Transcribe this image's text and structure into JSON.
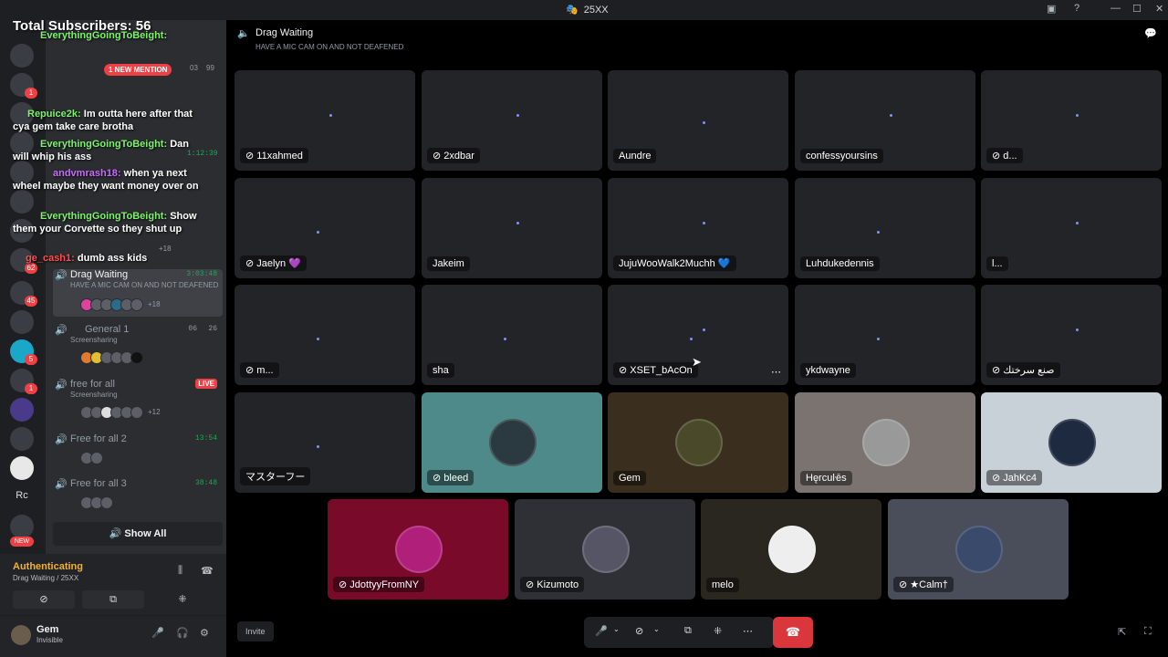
{
  "window": {
    "title": "25XX",
    "controls": [
      "inbox-icon",
      "help-icon",
      "minimize",
      "maximize",
      "close"
    ]
  },
  "overlay": {
    "total_subscribers": "Total Subscribers: 56",
    "mention_pill": "1 NEW MENTION",
    "messages": [
      {
        "user": "EverythingGoingToBeight:",
        "text": ""
      },
      {
        "user": "Repuice2k:",
        "text": "Im outta here after that cya gem take care brotha"
      },
      {
        "user": "EverythingGoingToBeight:",
        "text": "Dan will whip his ass"
      },
      {
        "user": "andvmrash18:",
        "text": "when ya next wheel maybe they want money over on"
      },
      {
        "user": "EverythingGoingToBeight:",
        "text": "Show them your Corvette so they shut up"
      },
      {
        "user": "ge_cash1:",
        "text": "dumb ass kids"
      }
    ]
  },
  "servers": {
    "badges": [
      "1",
      "62",
      "45",
      "5",
      "1"
    ],
    "rc_label": "Rc",
    "new_label": "NEW"
  },
  "channels": {
    "top_counts": {
      "left": "03",
      "right": "99"
    },
    "time_top": "1:12:39",
    "plus_top": "+18",
    "list": [
      {
        "name": "Drag Waiting",
        "sub": "HAVE A MIC CAM ON AND NOT DEAFENED",
        "time": "3:03:48",
        "more": "+18"
      },
      {
        "name": "General 1",
        "sub": "Screensharing",
        "cams": "06",
        "users": "26"
      },
      {
        "name": "free for all",
        "sub": "Screensharing",
        "live": "LIVE",
        "more": "+12"
      },
      {
        "name": "Free for all 2",
        "time": "13:54"
      },
      {
        "name": "Free for all 3",
        "time": "38:48"
      }
    ],
    "show_all": "Show All"
  },
  "voice_panel": {
    "status": "Authenticating",
    "location": "Drag Waiting / 25XX"
  },
  "user_panel": {
    "name": "Gem",
    "status": "Invisible"
  },
  "header": {
    "channel": "Drag Waiting",
    "subtitle": "HAVE A MIC CAM ON AND NOT DEAFENED"
  },
  "tiles": [
    {
      "label": "11xahmed",
      "muted": true
    },
    {
      "label": "2xdbar",
      "muted": true
    },
    {
      "label": "Aundre",
      "muted": false
    },
    {
      "label": "confessyoursins",
      "muted": false
    },
    {
      "label": "d...",
      "muted": true
    },
    {
      "label": "Jaelyn 💜",
      "muted": true
    },
    {
      "label": "Jakeim",
      "muted": false
    },
    {
      "label": "JujuWooWalk2Muchh 💙",
      "muted": false
    },
    {
      "label": "Luhdukedennis",
      "muted": false
    },
    {
      "label": "l...",
      "muted": false
    },
    {
      "label": "m...",
      "muted": true
    },
    {
      "label": "sha",
      "muted": false
    },
    {
      "label": "XSET_bAcOn",
      "muted": true
    },
    {
      "label": "ykdwayne",
      "muted": false
    },
    {
      "label": "صنع سرختك",
      "muted": true
    },
    {
      "label": "マスターフー",
      "muted": false
    },
    {
      "label": "bleed",
      "muted": true
    },
    {
      "label": "Gem",
      "muted": false
    },
    {
      "label": "Hęrcuŀēs",
      "muted": false
    },
    {
      "label": "JahKc4",
      "muted": true
    },
    {
      "label": "JdottyyFromNY",
      "muted": true
    },
    {
      "label": "Kizumoto",
      "muted": true
    },
    {
      "label": "melo",
      "muted": false
    },
    {
      "label": "★Calm†",
      "muted": true
    }
  ],
  "bottom": {
    "invite": "Invite"
  },
  "colors": {
    "accent": "#5865f2",
    "danger": "#da373c",
    "online": "#23a559",
    "warning": "#f0b232",
    "bleed_bg": "#4e8a8a",
    "gem_bg": "#3a2e1e",
    "hercules_bg": "#7a7370",
    "jahkc4_bg": "#c8d0d8",
    "jdotty_bg": "#7a0a2a"
  }
}
